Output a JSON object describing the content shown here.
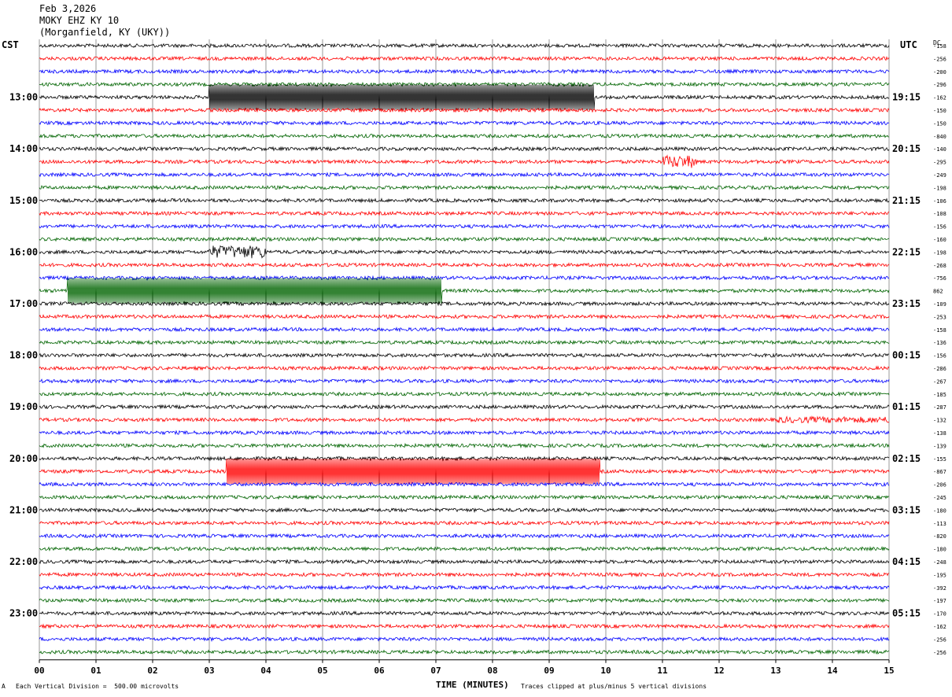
{
  "header": {
    "date": "Feb 3,2026",
    "station": "MOKY EHZ KY 10",
    "location": "(Morganfield, KY (UKY))"
  },
  "left_corner_label": "CST",
  "right_corner_label": "UTC",
  "dc_label": "DC",
  "footer": {
    "scale_note": "Each Vertical Division =  500.00 microvolts",
    "clip_note": "Traces clipped at plus/minus 5 vertical divisions",
    "mark": "A"
  },
  "chart_data": {
    "type": "line",
    "title": "",
    "xlabel": "TIME (MINUTES)",
    "ylabel": "",
    "xlim": [
      0,
      15
    ],
    "x_ticks": [
      "00",
      "01",
      "02",
      "03",
      "04",
      "05",
      "06",
      "07",
      "08",
      "09",
      "10",
      "11",
      "12",
      "13",
      "14",
      "15"
    ],
    "grid": true,
    "traces_per_hour": 4,
    "minutes_per_trace": 15,
    "trace_count": 48,
    "trace_colors": [
      "#000000",
      "#ff0000",
      "#0000ff",
      "#006400"
    ],
    "left_hour_labels": [
      "13:00",
      "14:00",
      "15:00",
      "16:00",
      "17:00",
      "18:00",
      "19:00",
      "20:00",
      "21:00",
      "22:00",
      "23:00"
    ],
    "right_hour_labels": [
      "19:15",
      "20:15",
      "21:15",
      "22:15",
      "23:15",
      "00:15",
      "01:15",
      "02:15",
      "03:15",
      "04:15",
      "05:15"
    ],
    "dc_offsets": [
      "-158",
      "-256",
      "-200",
      "-296",
      "-162",
      "-150",
      "-150",
      "-840",
      "-140",
      "-295",
      "-249",
      "-198",
      "-106",
      "-108",
      "-156",
      "-160",
      "-198",
      "-268",
      "-756",
      "862",
      "-109",
      "-253",
      "-158",
      "-136",
      "-156",
      "-286",
      "-267",
      "-185",
      "-287",
      "-132",
      "-138",
      "-139",
      "-155",
      "-867",
      "-206",
      "-245",
      "-180",
      "-113",
      "-820",
      "-180",
      "-248",
      "-195",
      "-392",
      "-197",
      "-170",
      "-162",
      "-256",
      "-256"
    ],
    "events": [
      {
        "trace": 4,
        "start_min": 3.0,
        "end_min": 9.8,
        "type": "clipped_oscillation"
      },
      {
        "trace": 16,
        "start_min": 3.0,
        "end_min": 4.0,
        "type": "burst"
      },
      {
        "trace": 19,
        "start_min": 0.5,
        "end_min": 7.1,
        "type": "clipped_oscillation"
      },
      {
        "trace": 33,
        "start_min": 3.3,
        "end_min": 9.9,
        "type": "clipped_oscillation"
      },
      {
        "trace": 9,
        "start_min": 11.0,
        "end_min": 11.6,
        "type": "burst"
      },
      {
        "trace": 29,
        "start_min": 13.0,
        "end_min": 15.0,
        "type": "noise_increase"
      }
    ]
  }
}
